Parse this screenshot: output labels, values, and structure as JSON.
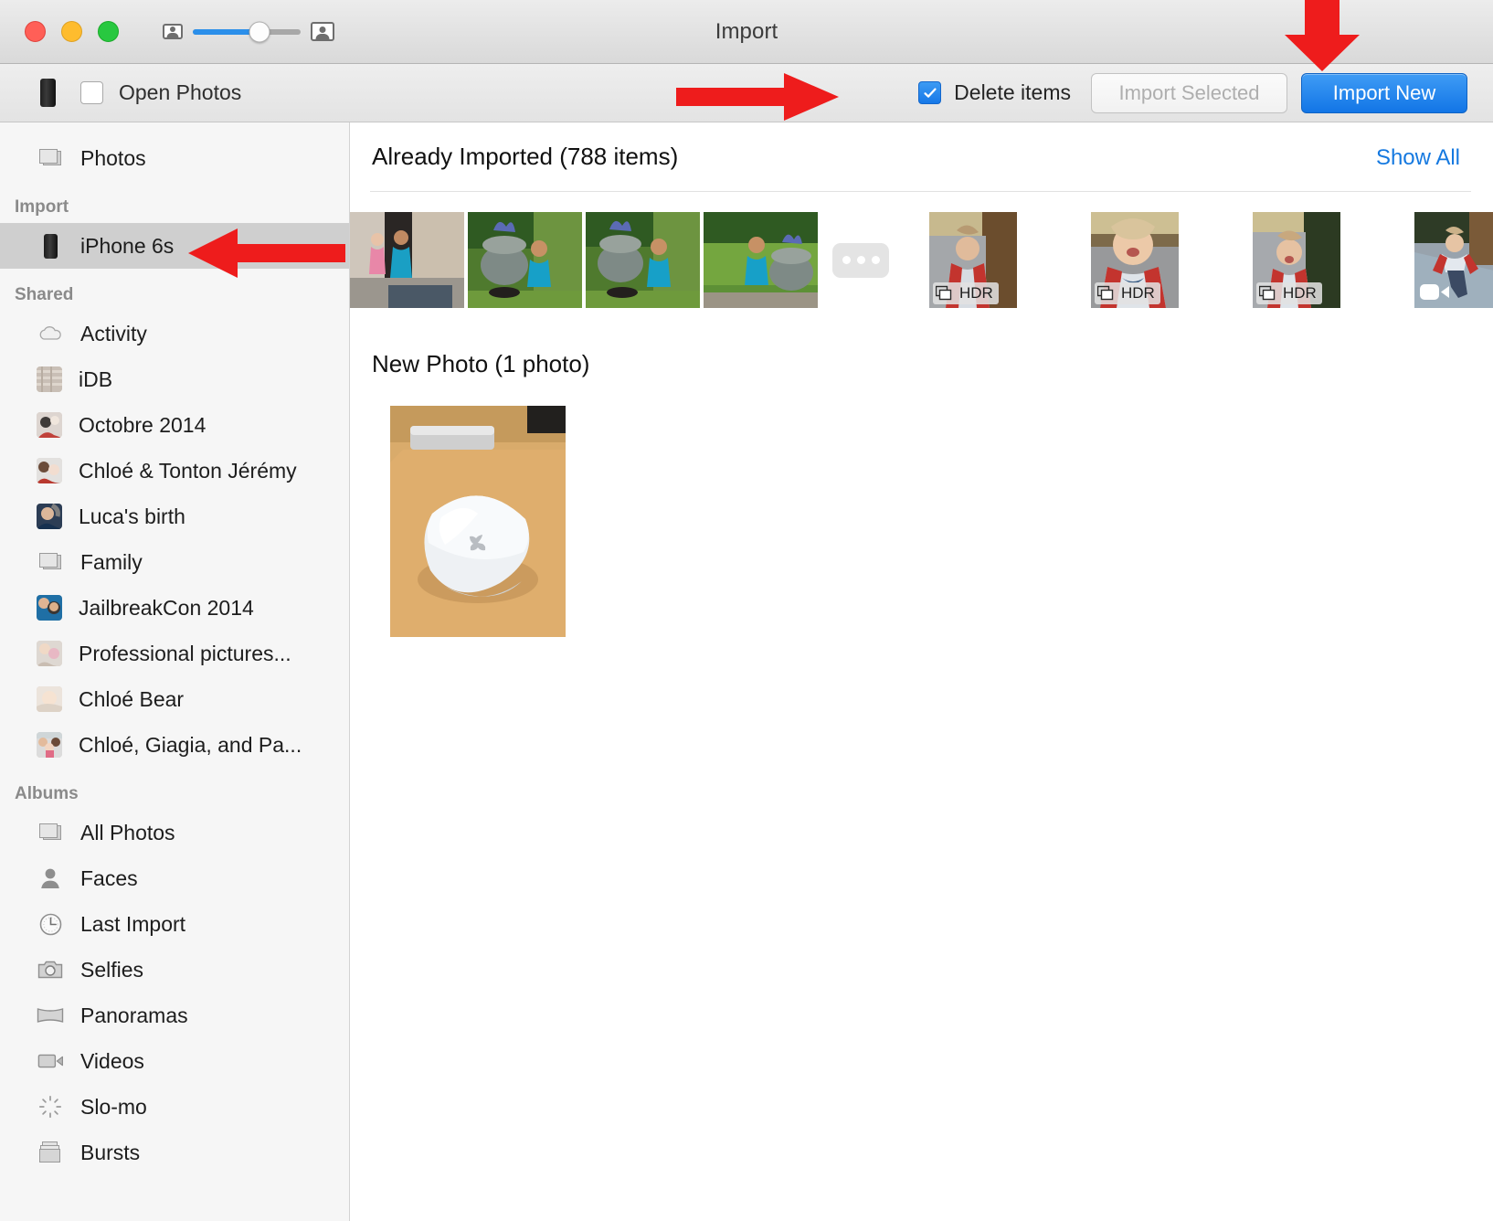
{
  "window": {
    "title": "Import",
    "traffic_lights": [
      "close",
      "minimize",
      "zoom"
    ],
    "zoom_slider": {
      "min_icon": "small-thumbnail-icon",
      "max_icon": "large-thumbnail-icon",
      "value_percent": 62
    }
  },
  "toolbar": {
    "device_icon": "iphone-icon",
    "open_photos_label": "Open Photos",
    "open_photos_checked": false,
    "delete_items_label": "Delete items",
    "delete_items_checked": true,
    "import_selected_label": "Import Selected",
    "import_selected_enabled": false,
    "import_new_label": "Import New",
    "accent_color": "#1275e6",
    "link_color": "#1579e0"
  },
  "sidebar": {
    "top": [
      {
        "label": "Photos",
        "icon": "photos-stack-icon",
        "selected": false
      }
    ],
    "sections": [
      {
        "header": "Import",
        "items": [
          {
            "label": "iPhone 6s",
            "icon": "iphone-icon",
            "selected": true
          }
        ]
      },
      {
        "header": "Shared",
        "items": [
          {
            "label": "Activity",
            "icon": "cloud-icon",
            "selected": false
          },
          {
            "label": "iDB",
            "icon": "album-thumbnail",
            "selected": false
          },
          {
            "label": "Octobre 2014",
            "icon": "album-thumbnail",
            "selected": false
          },
          {
            "label": "Chloé & Tonton Jérémy",
            "icon": "album-thumbnail",
            "selected": false
          },
          {
            "label": "Luca's birth",
            "icon": "album-thumbnail",
            "selected": false
          },
          {
            "label": "Family",
            "icon": "photos-stack-icon",
            "selected": false
          },
          {
            "label": "JailbreakCon 2014",
            "icon": "album-thumbnail",
            "selected": false
          },
          {
            "label": "Professional pictures...",
            "icon": "album-thumbnail",
            "selected": false
          },
          {
            "label": "Chloé Bear",
            "icon": "album-thumbnail",
            "selected": false
          },
          {
            "label": "Chloé, Giagia, and Pa...",
            "icon": "album-thumbnail",
            "selected": false
          }
        ]
      },
      {
        "header": "Albums",
        "items": [
          {
            "label": "All Photos",
            "icon": "photos-stack-icon",
            "selected": false
          },
          {
            "label": "Faces",
            "icon": "person-icon",
            "selected": false
          },
          {
            "label": "Last Import",
            "icon": "clock-icon",
            "selected": false
          },
          {
            "label": "Selfies",
            "icon": "camera-icon",
            "selected": false
          },
          {
            "label": "Panoramas",
            "icon": "panorama-icon",
            "selected": false
          },
          {
            "label": "Videos",
            "icon": "video-camera-icon",
            "selected": false
          },
          {
            "label": "Slo-mo",
            "icon": "slomo-icon",
            "selected": false
          },
          {
            "label": "Bursts",
            "icon": "bursts-icon",
            "selected": false
          }
        ]
      }
    ]
  },
  "main": {
    "already_imported": {
      "title": "Already Imported (788 items)",
      "show_all_label": "Show All",
      "item_count": 788,
      "thumbnails": [
        {
          "badge": "none",
          "alt": "two-children-on-doorstep"
        },
        {
          "badge": "none",
          "alt": "toddler-by-flower-pot"
        },
        {
          "badge": "none",
          "alt": "toddler-by-flower-pot-2"
        },
        {
          "badge": "none",
          "alt": "toddler-reaching-into-pot"
        },
        {
          "badge": "hdr",
          "alt": "girl-in-red-cardigan-on-path"
        },
        {
          "badge": "hdr",
          "alt": "girl-smiling-closeup"
        },
        {
          "badge": "hdr",
          "alt": "girl-on-sidewalk"
        },
        {
          "badge": "video",
          "alt": "girl-running-on-sidewalk-video"
        }
      ],
      "more_button": "more-ellipsis",
      "hdr_badge_label": "HDR"
    },
    "new_photo": {
      "title": "New Photo (1 photo)",
      "count": 1,
      "thumbnails": [
        {
          "badge": "none",
          "alt": "apple-magic-mouse-on-desk"
        }
      ]
    }
  },
  "annotations": {
    "arrow_color": "#ee1c1c",
    "arrows": [
      {
        "name": "arrow-to-import-new",
        "points_to": "Import New"
      },
      {
        "name": "arrow-to-delete-items",
        "points_to": "Delete items"
      },
      {
        "name": "arrow-to-iphone-6s",
        "points_to": "iPhone 6s"
      }
    ]
  }
}
